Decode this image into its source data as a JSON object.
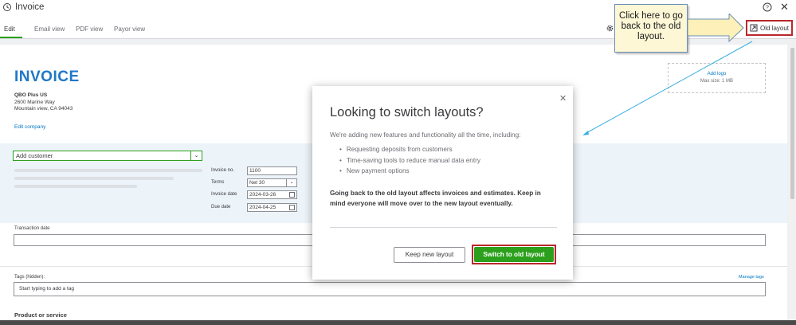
{
  "window": {
    "title": "Invoice"
  },
  "tabs": [
    {
      "label": "Edit"
    },
    {
      "label": "Email view"
    },
    {
      "label": "PDF view"
    },
    {
      "label": "Payor view"
    }
  ],
  "header_actions": {
    "old_layout_label": "Old layout"
  },
  "callout": {
    "text": "Click here to go back to the old layout."
  },
  "invoice": {
    "heading": "INVOICE",
    "company_name": "QBO Plus US",
    "address_line1": "2600 Marine Way",
    "address_line2": "Mountain view, CA 94043",
    "edit_company_label": "Edit company",
    "logo_add_label": "Add logo",
    "logo_size_label": "Max size: 1 MB",
    "customer_placeholder": "Add customer",
    "fields": {
      "invoice_no_label": "Invoice no.",
      "invoice_no_value": "1100",
      "terms_label": "Terms",
      "terms_value": "Net 30",
      "invoice_date_label": "Invoice date",
      "invoice_date_value": "2024-03-26",
      "due_date_label": "Due date",
      "due_date_value": "2024-04-25"
    },
    "transaction_date_label": "Transaction date",
    "tags_label": "Tags (hidden):",
    "manage_tags_label": "Manage tags",
    "tags_placeholder": "Start typing to add a tag",
    "product_service_label": "Product or service"
  },
  "modal": {
    "title": "Looking to switch layouts?",
    "intro": "We're adding new features and functionality all the time, including:",
    "bullets": [
      "Requesting deposits from customers",
      "Time-saving tools to reduce manual data entry",
      "New payment options"
    ],
    "warning": "Going back to the old layout affects invoices and estimates. Keep in mind everyone will move over to the new layout eventually.",
    "keep_label": "Keep new layout",
    "switch_label": "Switch to old layout"
  },
  "colors": {
    "accent_green": "#2ca01c",
    "link_blue": "#0077c5",
    "heading_blue": "#1f78c8",
    "highlight_red": "#b8282c",
    "callout_fill": "#fdf7d6"
  }
}
